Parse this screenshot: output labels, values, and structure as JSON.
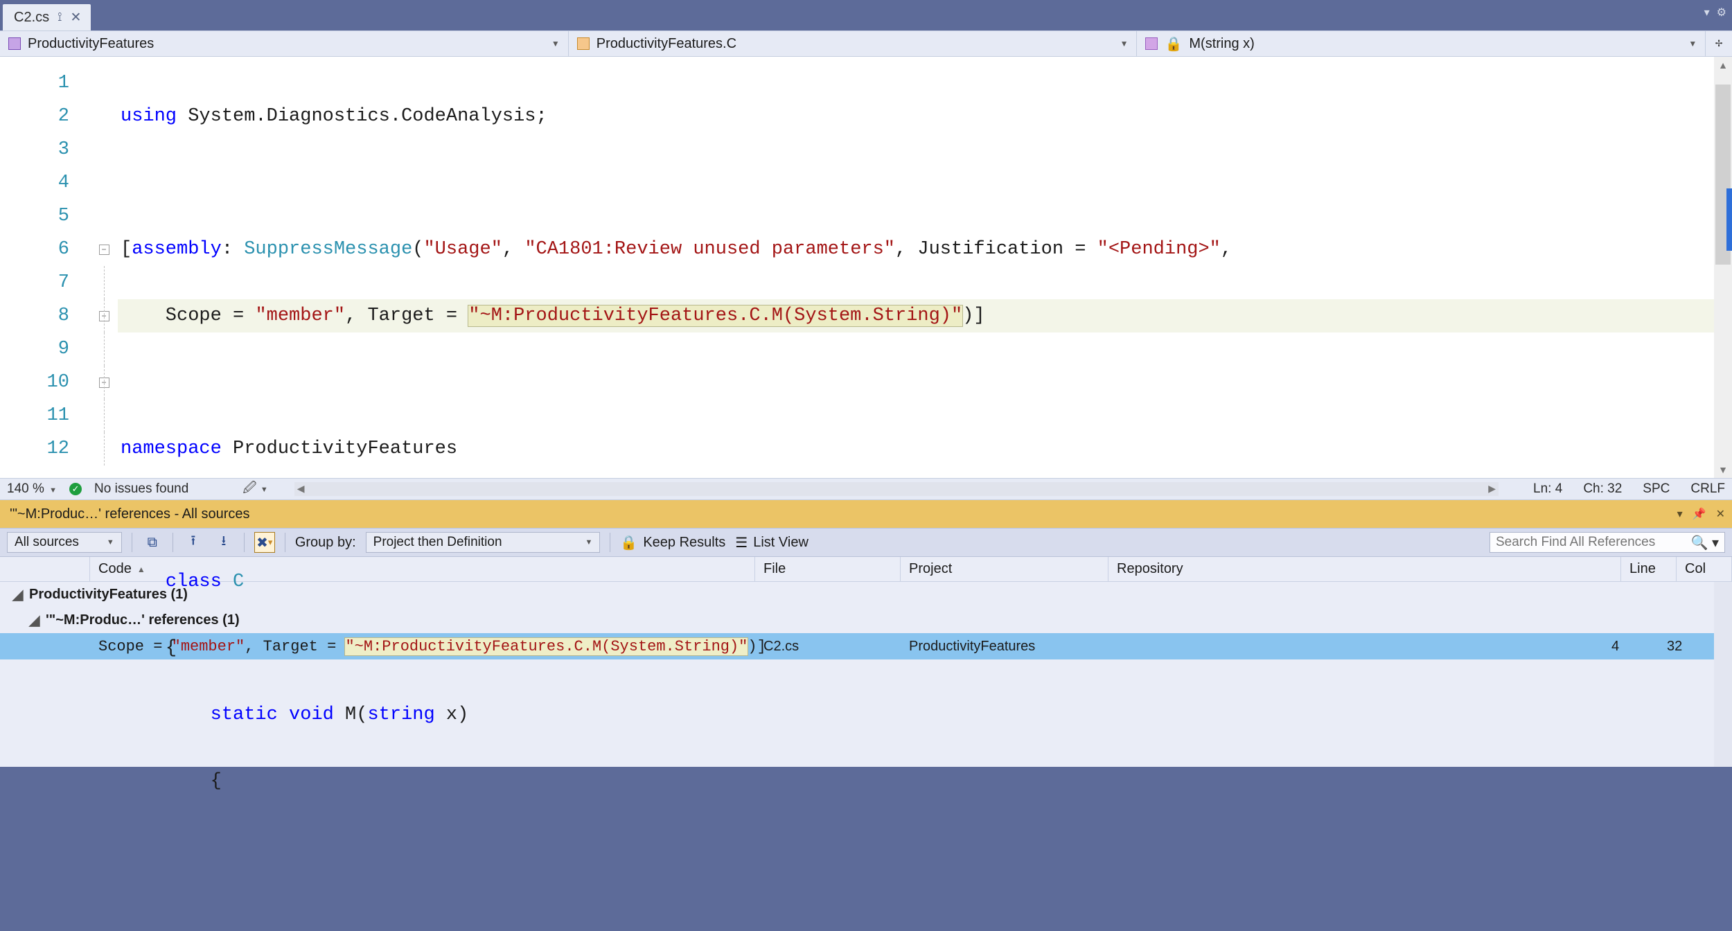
{
  "tab": {
    "filename": "C2.cs"
  },
  "nav": {
    "namespace_label": "ProductivityFeatures",
    "class_label": "ProductivityFeatures.C",
    "member_label": "M(string x)"
  },
  "code": {
    "line_numbers": [
      "1",
      "2",
      "3",
      "4",
      "5",
      "6",
      "7",
      "8",
      "9",
      "10",
      "11",
      "12"
    ]
  },
  "status": {
    "zoom": "140 %",
    "issues": "No issues found",
    "ln": "Ln: 4",
    "ch": "Ch: 32",
    "spc": "SPC",
    "crlf": "CRLF"
  },
  "refs": {
    "title": "'\"~M:Produc…' references - All sources",
    "all_sources": "All sources",
    "group_by_label": "Group by:",
    "group_by_value": "Project then Definition",
    "keep_results": "Keep Results",
    "list_view": "List View",
    "search_placeholder": "Search Find All References",
    "columns": {
      "code": "Code",
      "file": "File",
      "project": "Project",
      "repository": "Repository",
      "line": "Line",
      "col": "Col"
    },
    "group_project": "ProductivityFeatures  (1)",
    "group_def": "'\"~M:Produc…' references  (1)",
    "result": {
      "code_prefix": "Scope = ",
      "code_str1": "\"member\"",
      "code_mid": ", Target = ",
      "code_match": "\"~M:ProductivityFeatures.C.M(System.String)\"",
      "code_suffix": ")]",
      "file": "C2.cs",
      "project": "ProductivityFeatures",
      "repository": "",
      "line": "4",
      "col": "32"
    }
  }
}
